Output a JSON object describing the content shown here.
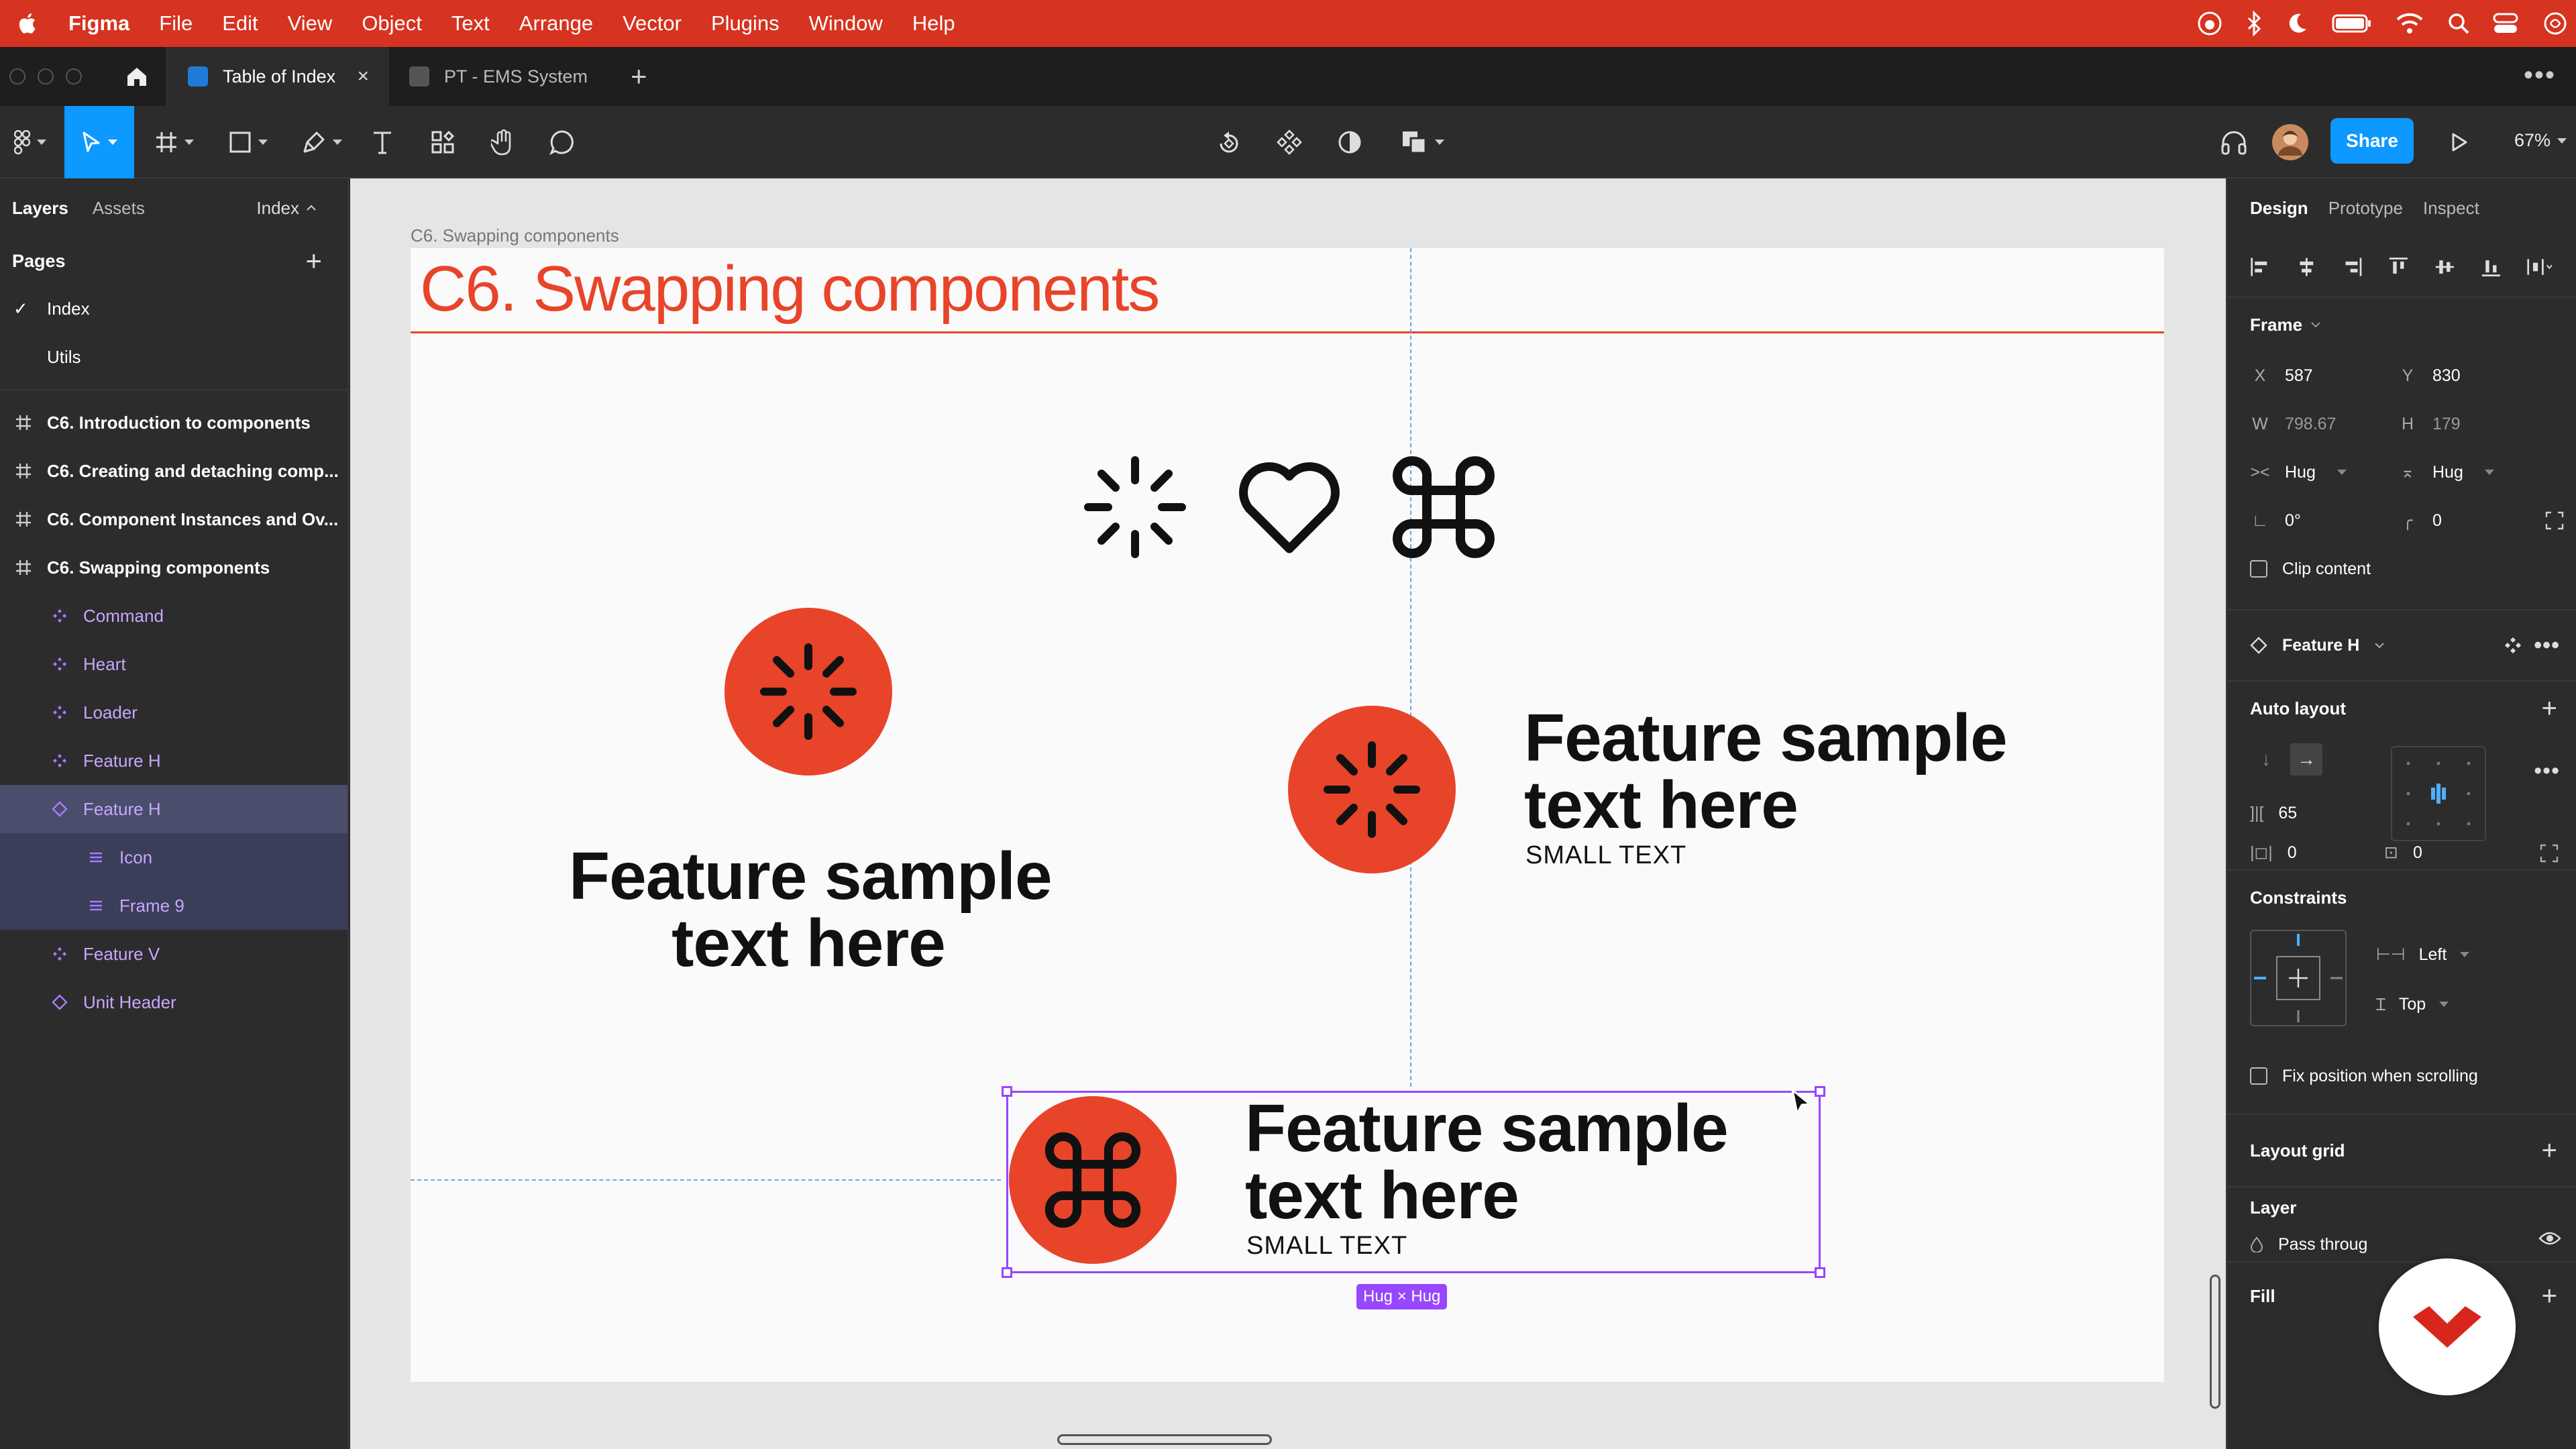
{
  "menubar": {
    "app": "Figma",
    "items": [
      "File",
      "Edit",
      "View",
      "Object",
      "Text",
      "Arrange",
      "Vector",
      "Plugins",
      "Window",
      "Help"
    ]
  },
  "tabs": [
    {
      "label": "Table of Index",
      "active": true
    },
    {
      "label": "PT - EMS System",
      "active": false
    }
  ],
  "toolbar": {
    "share_label": "Share",
    "zoom": "67%"
  },
  "left_panel": {
    "tab_layers": "Layers",
    "tab_assets": "Assets",
    "page_dropdown": "Index",
    "pages_title": "Pages",
    "pages": [
      "Index",
      "Utils"
    ],
    "frames": [
      "C6. Introduction to components",
      "C6. Creating and detaching comp...",
      "C6. Component Instances and Ov...",
      "C6. Swapping components"
    ],
    "children": [
      {
        "label": "Command",
        "kind": "component"
      },
      {
        "label": "Heart",
        "kind": "component"
      },
      {
        "label": "Loader",
        "kind": "component"
      },
      {
        "label": "Feature H",
        "kind": "component"
      },
      {
        "label": "Feature H",
        "kind": "instance"
      },
      {
        "label": "Icon",
        "kind": "child"
      },
      {
        "label": "Frame 9",
        "kind": "child"
      },
      {
        "label": "Feature V",
        "kind": "component"
      },
      {
        "label": "Unit Header",
        "kind": "instance"
      }
    ]
  },
  "canvas": {
    "frame_label": "C6. Swapping components",
    "title": "C6.  Swapping components",
    "feature_title_line1": "Feature sample",
    "feature_title_line2": "text here",
    "small_text": "SMALL TEXT",
    "hug_badge": "Hug × Hug"
  },
  "right_panel": {
    "tab_design": "Design",
    "tab_prototype": "Prototype",
    "tab_inspect": "Inspect",
    "frame_title": "Frame",
    "x_label": "X",
    "x": "587",
    "y_label": "Y",
    "y": "830",
    "w_label": "W",
    "w": "798.67",
    "h_label": "H",
    "h": "179",
    "hug_w": "Hug",
    "hug_h": "Hug",
    "rotation": "0°",
    "radius": "0",
    "clip_content": "Clip content",
    "instance_name": "Feature H",
    "auto_layout_title": "Auto layout",
    "spacing": "65",
    "padding_h": "0",
    "padding_v": "0",
    "constraints_title": "Constraints",
    "constraint_h": "Left",
    "constraint_v": "Top",
    "fix_position": "Fix position when scrolling",
    "layout_grid_title": "Layout grid",
    "layer_title": "Layer",
    "blend": "Pass throug",
    "fill_title": "Fill"
  },
  "colors": {
    "accent_red": "#e8442a",
    "menubar_red": "#d63320",
    "selection_purple": "#9747ff",
    "figma_blue": "#0d99ff"
  }
}
